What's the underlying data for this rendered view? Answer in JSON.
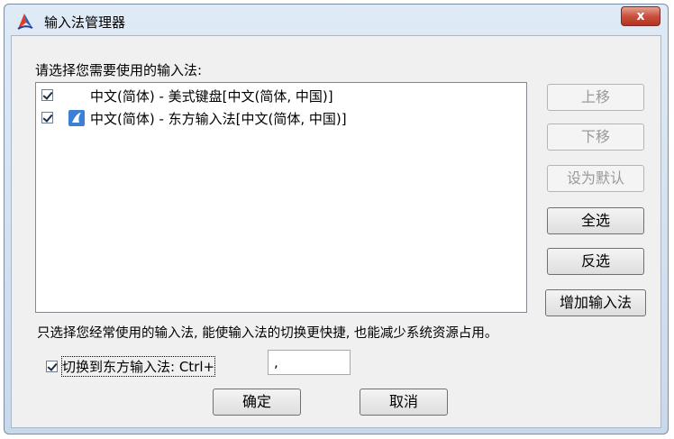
{
  "window": {
    "title": "输入法管理器",
    "close_label": "x"
  },
  "list": {
    "prompt": "请选择您需要使用的输入法:",
    "items": [
      {
        "label": "中文(简体) - 美式键盘[中文(简体, 中国)]",
        "checked": true,
        "icon": "none"
      },
      {
        "label": "中文(简体) - 东方输入法[中文(简体, 中国)]",
        "checked": true,
        "icon": "dongfang-ime-icon"
      }
    ]
  },
  "side_buttons": {
    "move_up": "上移",
    "move_down": "下移",
    "set_default": "设为默认",
    "select_all": "全选",
    "invert": "反选",
    "add_ime": "增加输入法"
  },
  "hint": "只选择您经常使用的输入法, 能使输入法的切换更快捷, 也能减少系统资源占用。",
  "shortcut": {
    "label": "切换到东方输入法: Ctrl+",
    "value": ",",
    "checked": true
  },
  "buttons": {
    "ok": "确定",
    "cancel": "取消"
  },
  "colors": {
    "accent": "#3b7fd6",
    "close": "#c9503e"
  }
}
